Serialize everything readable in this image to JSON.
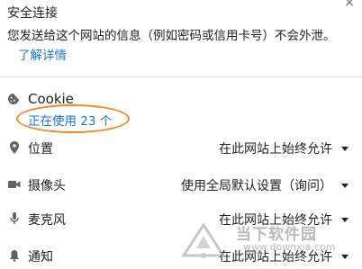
{
  "header": {
    "title": "安全连接",
    "close_glyph": "×"
  },
  "description": {
    "text": "您发送给这个网站的信息（例如密码或信用卡号）不会外泄。",
    "link": "了解详情"
  },
  "cookie": {
    "title": "Cookie",
    "in_use": "正在使用 23 个"
  },
  "permissions": [
    {
      "label": "位置",
      "value": "在此网站上始终允许",
      "icon": "location-icon"
    },
    {
      "label": "摄像头",
      "value": "使用全局默认设置（询问）",
      "icon": "camera-icon"
    },
    {
      "label": "麦克风",
      "value": "在此网站上始终允许",
      "icon": "microphone-icon"
    },
    {
      "label": "通知",
      "value": "在此网站上始终允许",
      "icon": "bell-icon"
    }
  ],
  "watermark": {
    "name": "当下软件园",
    "url": "www.downxia.com"
  },
  "colors": {
    "link": "#1a73e8",
    "highlight_ellipse": "#f08a24",
    "text": "#202124"
  }
}
